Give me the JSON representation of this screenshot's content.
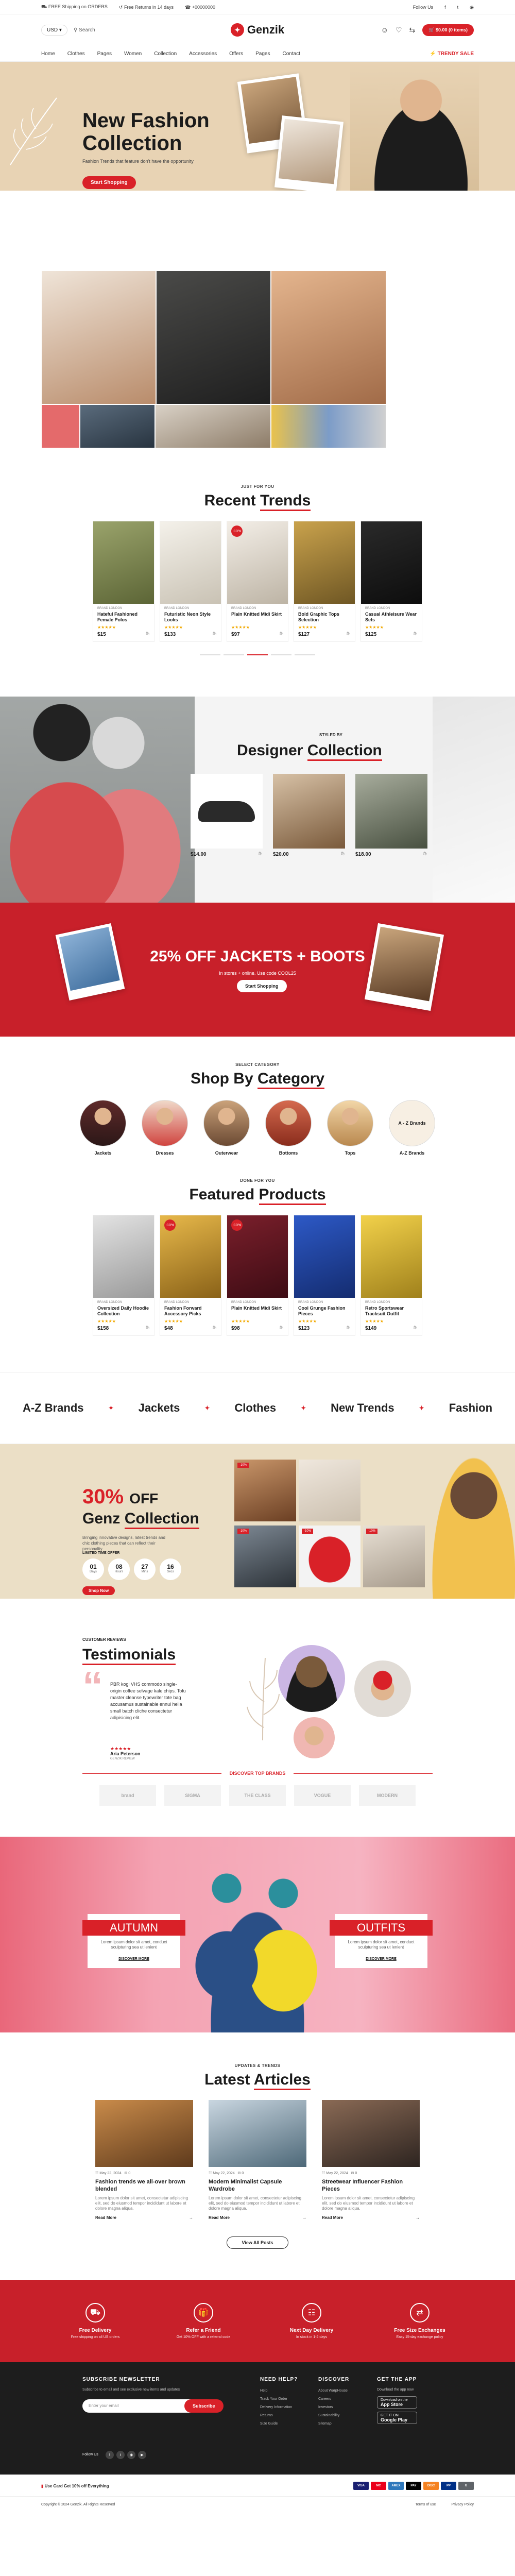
{
  "topbar": {
    "shipping": "FREE Shipping on ORDERS",
    "returns": "Free Returns in 14 days",
    "phone": "+00000000",
    "follow": "Follow Us"
  },
  "header": {
    "currency": "USD",
    "search_placeholder": "Search",
    "logo": "Genzik",
    "cart": "$0.00 (0 items)"
  },
  "nav": {
    "items": [
      "Home",
      "Clothes",
      "Pages",
      "Women",
      "Collection",
      "Accessories",
      "Offers",
      "Pages",
      "Contact"
    ],
    "deals": "TRENDY SALE"
  },
  "hero": {
    "title_line1": "New Fashion",
    "title_line2": "Collection",
    "subtitle": "Fashion Trends that feature don't have the opportunity",
    "button": "Start Shopping"
  },
  "trends": {
    "kicker": "JUST FOR YOU",
    "title_plain": "Recent",
    "title_underlined": "Trends",
    "products": [
      {
        "cat": "BRAND LONDON",
        "name": "Hateful Fashioned Female Polos",
        "price": "$15",
        "badge": ""
      },
      {
        "cat": "BRAND LONDON",
        "name": "Futuristic Neon Style Looks",
        "price": "$133",
        "badge": ""
      },
      {
        "cat": "BRAND LONDON",
        "name": "Plain Knitted Midi Skirt",
        "price": "$97",
        "badge": "-10%"
      },
      {
        "cat": "BRAND LONDON",
        "name": "Bold Graphic Tops Selection",
        "price": "$127",
        "badge": ""
      },
      {
        "cat": "BRAND LONDON",
        "name": "Casual Athleisure Wear Sets",
        "price": "$125",
        "badge": ""
      }
    ]
  },
  "designer": {
    "kicker": "STYLED BY",
    "title_plain": "Designer",
    "title_underlined": "Collection",
    "items": [
      {
        "price": "$14.00"
      },
      {
        "price": "$20.00"
      },
      {
        "price": "$18.00"
      }
    ]
  },
  "promo": {
    "title": "25% OFF JACKETS + BOOTS",
    "subtitle": "In stores + online. Use code COOL25",
    "button": "Start Shopping"
  },
  "categories": {
    "kicker": "SELECT CATEGORY",
    "title_plain": "Shop By",
    "title_underlined": "Category",
    "items": [
      "Jackets",
      "Dresses",
      "Outerwear",
      "Bottoms",
      "Tops",
      "A-Z Brands"
    ],
    "brands_circle": "A - Z Brands"
  },
  "featured": {
    "kicker": "DONE FOR YOU",
    "title_plain": "Featured",
    "title_underlined": "Products",
    "products": [
      {
        "cat": "BRAND LONDON",
        "name": "Oversized Daily Hoodie Collection",
        "price": "$158",
        "badge": ""
      },
      {
        "cat": "BRAND LONDON",
        "name": "Fashion Forward Accessory Picks",
        "price": "$48",
        "badge": "-10%"
      },
      {
        "cat": "BRAND LONDON",
        "name": "Plain Knitted Midi Skirt",
        "price": "$98",
        "badge": "-10%"
      },
      {
        "cat": "BRAND LONDON",
        "name": "Cool Grunge Fashion Pieces",
        "price": "$123",
        "badge": ""
      },
      {
        "cat": "BRAND LONDON",
        "name": "Retro Sportswear Tracksuit Outfit",
        "price": "$149",
        "badge": ""
      }
    ]
  },
  "marquee": {
    "items": [
      "A-Z Brands",
      "Jackets",
      "Clothes",
      "New Trends",
      "Fashion"
    ]
  },
  "genz": {
    "percent": "30%",
    "off": "OFF",
    "title_plain": "Genz",
    "title_underlined": "Collection",
    "desc": "Bringing innovative designs, latest trends and chic clothing pieces that can reflect their personality",
    "limited": "LIMITED TIME OFFER",
    "countdown": [
      {
        "value": "01",
        "unit": "Days"
      },
      {
        "value": "08",
        "unit": "Hours"
      },
      {
        "value": "27",
        "unit": "Mins"
      },
      {
        "value": "16",
        "unit": "Secs"
      }
    ],
    "button": "Shop Now",
    "badges": [
      "-10%",
      "-10%",
      "-10%",
      "-10%"
    ]
  },
  "testimonials": {
    "kicker": "CUSTOMER REVIEWS",
    "title": "Testimonials",
    "quote_mark": "“",
    "text": "PBR kogi VHS commodo single-origin coffee selvage kale chips. Tofu master cleanse typewriter tote bag accusamus sustainable ennui hella small batch cliche consectetur adipisicing elit.",
    "stars": "★★★★★",
    "name": "Aria Peterson",
    "role": "GENZIK REVIEW"
  },
  "brands": {
    "title": "DISCOVER TOP BRANDS",
    "items": [
      "brand",
      "SIGMA",
      "THE CLASS",
      "VOGUE",
      "MODERN"
    ]
  },
  "autumn": {
    "left_title": "AUTUMN",
    "left_text": "Lorem ipsum dolor sit amet, conduct sculpturing sea ut lenient",
    "left_link": "DISCOVER MORE",
    "right_title": "OUTFITS",
    "right_text": "Lorem ipsum dolor sit amet, conduct sculpturing sea ut lenient",
    "right_link": "DISCOVER MORE"
  },
  "articles": {
    "kicker": "UPDATES & TRENDS",
    "title_plain": "Latest",
    "title_underlined": "Articles",
    "items": [
      {
        "date": "May 22, 2024",
        "comments": "0",
        "title": "Fashion trends we all-over brown blended",
        "excerpt": "Lorem ipsum dolor sit amet, consectetur adipiscing elit, sed do eiusmod tempor incididunt ut labore et dolore magna aliqua.",
        "read": "Read More"
      },
      {
        "date": "May 22, 2024",
        "comments": "0",
        "title": "Modern Minimalist Capsule Wardrobe",
        "excerpt": "Lorem ipsum dolor sit amet, consectetur adipiscing elit, sed do eiusmod tempor incididunt ut labore et dolore magna aliqua.",
        "read": "Read More"
      },
      {
        "date": "May 22, 2024",
        "comments": "0",
        "title": "Streetwear Influencer Fashion Pieces",
        "excerpt": "Lorem ipsum dolor sit amet, consectetur adipiscing elit, sed do eiusmod tempor incididunt ut labore et dolore magna aliqua.",
        "read": "Read More"
      }
    ],
    "view_all": "View All Posts"
  },
  "features": [
    {
      "icon": "truck-icon",
      "title": "Free Delivery",
      "sub": "Free shipping on all US orders"
    },
    {
      "icon": "gift-icon",
      "title": "Refer a Friend",
      "sub": "Get 10% OFF with a referral code"
    },
    {
      "icon": "calendar-icon",
      "title": "Next Day Delivery",
      "sub": "In stock in 1-2 days"
    },
    {
      "icon": "exchange-icon",
      "title": "Free Size Exchanges",
      "sub": "Easy 15-day exchange policy"
    }
  ],
  "footer": {
    "newsletter_title": "SUBSCRIBE NEWSLETTER",
    "newsletter_sub": "Subscribe to email and see exclusive new items and updates",
    "email_placeholder": "Enter your email",
    "subscribe": "Subscribe",
    "follow_label": "Follow Us",
    "help_title": "NEED HELP?",
    "help_links": [
      "Help",
      "Track Your Order",
      "Delivery Information",
      "Returns",
      "Size Guide"
    ],
    "discover_title": "DISCOVER",
    "discover_links": [
      "About WarpHouse",
      "Careers",
      "Investors",
      "Sustainability",
      "Sitemap"
    ],
    "app_title": "GET THE APP",
    "app_sub": "Download the app now",
    "app_store_small": "Download on the",
    "app_store": "App Store",
    "play_small": "GET IT ON",
    "play": "Google Play"
  },
  "bottombar": {
    "promo": "Use Card Get 10% off Everything",
    "payments": [
      "VISA",
      "MC",
      "AMEX",
      "PAY",
      "DISC",
      "PP",
      "G"
    ]
  },
  "copyright": {
    "text": "Copyright © 2024 Genzik. All Rights Reserved",
    "terms": "Terms of use",
    "privacy": "Privacy Policy"
  },
  "colors": {
    "accent": "#d92128",
    "hero_bg": "#e8d3b4",
    "genz_bg": "#ebdfc6",
    "footer_bg": "#1d1d1d"
  }
}
